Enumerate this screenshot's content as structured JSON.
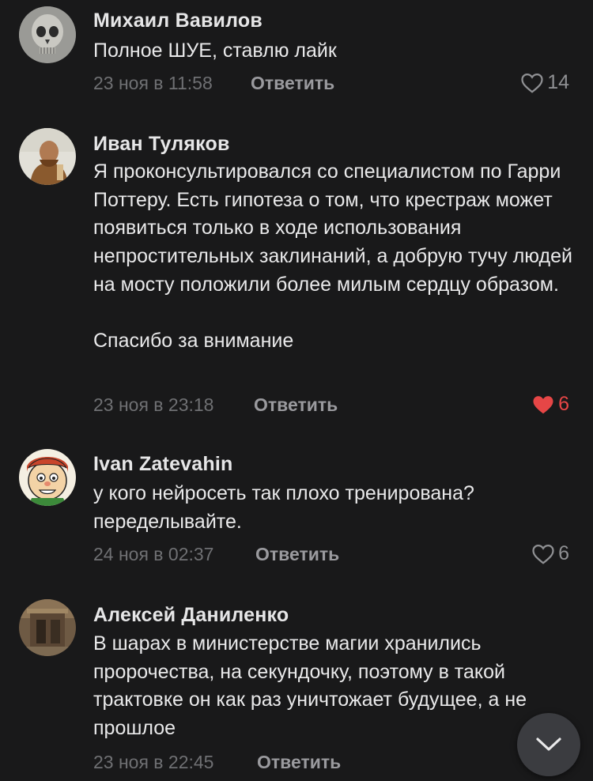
{
  "colors": {
    "background": "#19191a",
    "liked": "#e64646",
    "muted": "#6f7073"
  },
  "comments": [
    {
      "author": "Михаил Вавилов",
      "text": "Полное ШУЕ, ставлю лайк",
      "date": "23 ноя в 11:58",
      "reply": "Ответить",
      "likes": "14",
      "liked": false,
      "avatar_icon": "skull-avatar"
    },
    {
      "author": "Иван Туляков",
      "text": "Я проконсультировался со специалистом по Гарри Поттеру. Есть гипотеза о том, что крестраж может появиться только в ходе использования непростительных заклинаний, а добрую тучу людей на мосту положили более милым сердцу образом.\n\nСпасибо за внимание",
      "date": "23 ноя в 23:18",
      "reply": "Ответить",
      "likes": "6",
      "liked": true,
      "avatar_icon": "person-photo-avatar"
    },
    {
      "author": "Ivan Zatevahin",
      "text": "у кого нейросеть так плохо тренирована? переделывайте.",
      "date": "24 ноя в 02:37",
      "reply": "Ответить",
      "likes": "6",
      "liked": false,
      "avatar_icon": "cartoon-face-avatar"
    },
    {
      "author": "Алексей Даниленко",
      "text": "В шарах в министерстве магии хранились пророчества, на секундочку, поэтому в такой трактовке он как раз уничтожает будущее, а не прошлое",
      "date": "23 ноя в 22:45",
      "reply": "Ответить",
      "liked": false,
      "avatar_icon": "building-photo-avatar"
    }
  ],
  "scroll_button_icon": "chevron-down-icon"
}
